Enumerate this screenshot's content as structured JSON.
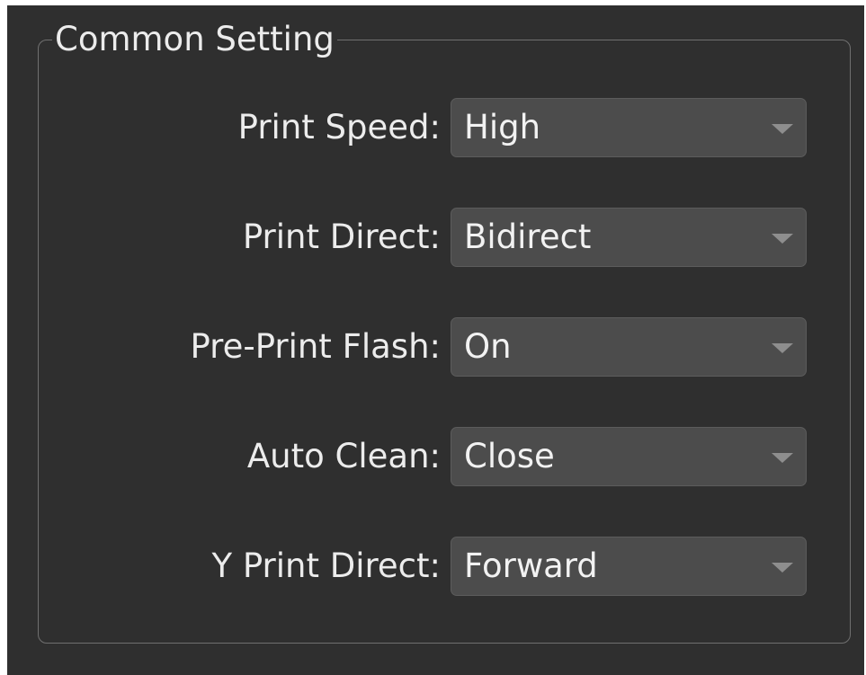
{
  "group": {
    "title": "Common Setting"
  },
  "settings": [
    {
      "label": "Print Speed:",
      "value": "High"
    },
    {
      "label": "Print Direct:",
      "value": "Bidirect"
    },
    {
      "label": "Pre-Print Flash:",
      "value": "On"
    },
    {
      "label": "Auto Clean:",
      "value": "Close"
    },
    {
      "label": "Y Print Direct:",
      "value": "Forward"
    }
  ],
  "icons": {
    "dropdown": "chevron-down-icon"
  },
  "colors": {
    "panel_background": "#2f2f2f",
    "select_background": "#4c4c4c",
    "text": "#ececec",
    "group_border": "#707070"
  }
}
